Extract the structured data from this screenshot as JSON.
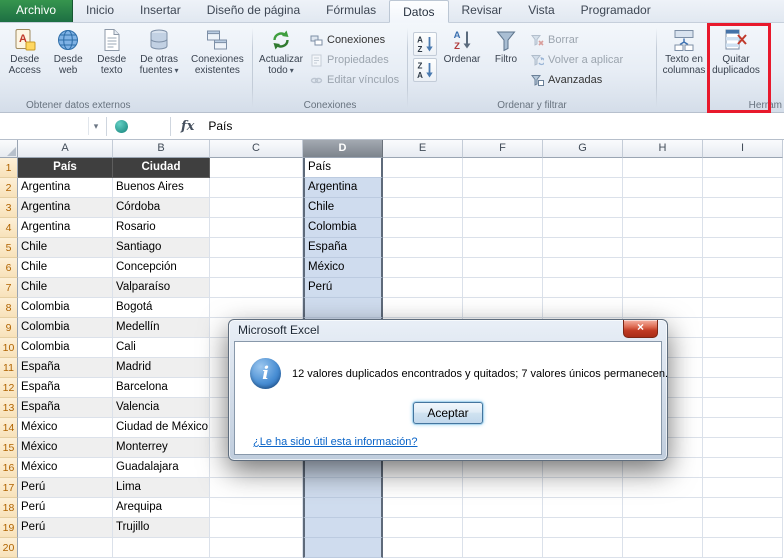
{
  "ribbon": {
    "tabs": [
      "Archivo",
      "Inicio",
      "Insertar",
      "Diseño de página",
      "Fórmulas",
      "Datos",
      "Revisar",
      "Vista",
      "Programador"
    ],
    "active_tab": "Datos",
    "file_tab": "Archivo",
    "external_group": {
      "label": "Obtener datos externos",
      "desde_access": "Desde Access",
      "desde_web": "Desde web",
      "desde_texto": "Desde texto",
      "de_otras_fuentes": "De otras fuentes",
      "conexiones_existentes": "Conexiones existentes"
    },
    "connections_group": {
      "label": "Conexiones",
      "actualizar_todo": "Actualizar todo",
      "conexiones": "Conexiones",
      "propiedades": "Propiedades",
      "editar_vinculos": "Editar vínculos"
    },
    "sort_group": {
      "label": "Ordenar y filtrar",
      "ordenar": "Ordenar",
      "filtro": "Filtro",
      "borrar": "Borrar",
      "volver_a_aplicar": "Volver a aplicar",
      "avanzadas": "Avanzadas"
    },
    "tools_group": {
      "label": "Herram",
      "texto_en_columnas": "Texto en columnas",
      "quitar_duplicados": "Quitar duplicados"
    }
  },
  "formula_bar": {
    "name_box": "",
    "fx": "fx",
    "content": "País"
  },
  "sheet": {
    "columns": [
      "A",
      "B",
      "C",
      "D",
      "E",
      "F",
      "G",
      "H",
      "I"
    ],
    "selected_column": "D",
    "rows": [
      {
        "n": 1,
        "A": "País",
        "B": "Ciudad",
        "D": "País"
      },
      {
        "n": 2,
        "A": "Argentina",
        "B": "Buenos Aires",
        "D": "Argentina"
      },
      {
        "n": 3,
        "A": "Argentina",
        "B": "Córdoba",
        "D": "Chile"
      },
      {
        "n": 4,
        "A": "Argentina",
        "B": "Rosario",
        "D": "Colombia"
      },
      {
        "n": 5,
        "A": "Chile",
        "B": "Santiago",
        "D": "España"
      },
      {
        "n": 6,
        "A": "Chile",
        "B": "Concepción",
        "D": "México"
      },
      {
        "n": 7,
        "A": "Chile",
        "B": "Valparaíso",
        "D": "Perú"
      },
      {
        "n": 8,
        "A": "Colombia",
        "B": "Bogotá"
      },
      {
        "n": 9,
        "A": "Colombia",
        "B": "Medellín"
      },
      {
        "n": 10,
        "A": "Colombia",
        "B": "Cali"
      },
      {
        "n": 11,
        "A": "España",
        "B": "Madrid"
      },
      {
        "n": 12,
        "A": "España",
        "B": "Barcelona"
      },
      {
        "n": 13,
        "A": "España",
        "B": "Valencia"
      },
      {
        "n": 14,
        "A": "México",
        "B": "Ciudad de México"
      },
      {
        "n": 15,
        "A": "México",
        "B": "Monterrey"
      },
      {
        "n": 16,
        "A": "México",
        "B": "Guadalajara"
      },
      {
        "n": 17,
        "A": "Perú",
        "B": "Lima"
      },
      {
        "n": 18,
        "A": "Perú",
        "B": "Arequipa"
      },
      {
        "n": 19,
        "A": "Perú",
        "B": "Trujillo"
      },
      {
        "n": 20
      }
    ]
  },
  "dialog": {
    "title": "Microsoft Excel",
    "message": "12 valores duplicados encontrados y quitados; 7 valores únicos permanecen.",
    "ok_label": "Aceptar",
    "close_glyph": "×",
    "help_link": "¿Le ha sido útil esta información?"
  },
  "colors": {
    "selection_fill": "#cfdcee",
    "file_tab_green": "#1e7145",
    "annotation_red": "#e8192c",
    "table_header_dark": "#3f3f3f"
  }
}
